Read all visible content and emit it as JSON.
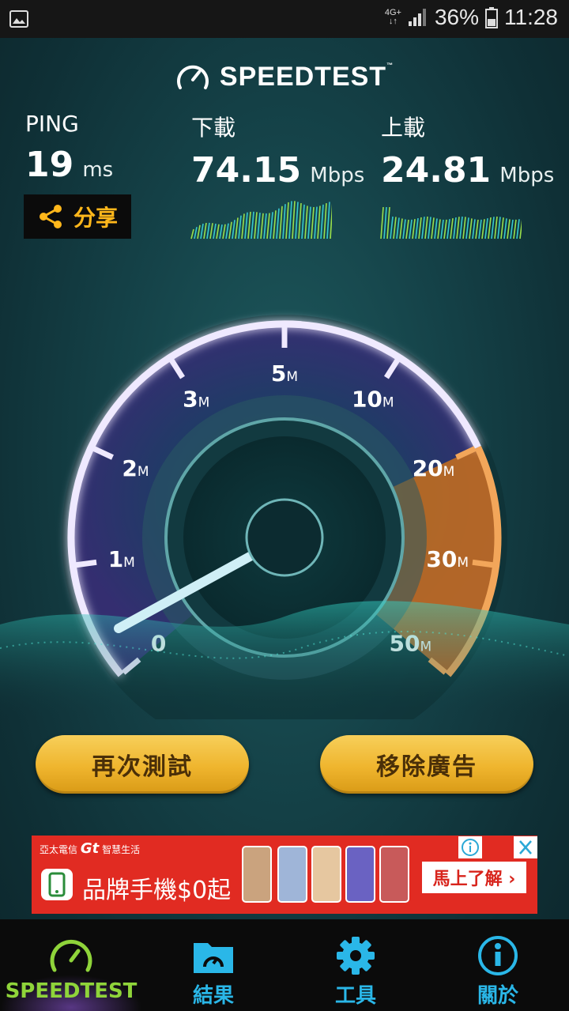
{
  "status_bar": {
    "network_top": "4G+",
    "network_bottom": "↓↑",
    "battery": "36%",
    "time": "11:28"
  },
  "header": {
    "brand": "SPEEDTEST",
    "trademark": "™"
  },
  "metrics": {
    "ping": {
      "label": "PING",
      "value": "19",
      "unit": "ms"
    },
    "download": {
      "label": "下載",
      "value": "74.15",
      "unit": "Mbps"
    },
    "upload": {
      "label": "上載",
      "value": "24.81",
      "unit": "Mbps"
    }
  },
  "share": {
    "label": "分享"
  },
  "gauge": {
    "ticks": [
      "0",
      "1",
      "2",
      "3",
      "5",
      "10",
      "20",
      "30",
      "50"
    ],
    "unit_suffix": "M"
  },
  "actions": {
    "retest": "再次測試",
    "remove_ads": "移除廣告"
  },
  "ad": {
    "company": "亞太電信",
    "logo": "Gt",
    "slogan": "智慧生活",
    "title": "品牌手機$0起",
    "cta": "馬上了解 ›"
  },
  "nav": {
    "items": [
      {
        "label": "SPEEDTEST",
        "icon": "speedtest-icon",
        "active": true
      },
      {
        "label": "結果",
        "icon": "results-folder-icon",
        "active": false
      },
      {
        "label": "工具",
        "icon": "gear-icon",
        "active": false
      },
      {
        "label": "關於",
        "icon": "info-icon",
        "active": false
      }
    ]
  },
  "colors": {
    "accent_yellow": "#ffb71b",
    "nav_active": "#8fd43a",
    "nav_inactive": "#2ab7e8",
    "gauge_orange": "#e8801e",
    "ad_red": "#e12b22"
  }
}
